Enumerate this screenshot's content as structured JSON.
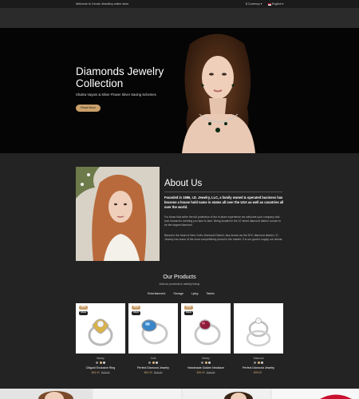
{
  "topbar": {
    "welcome": "Welcome to Cerato Jewellery online store",
    "currency": "$ Currency ▾",
    "language": "English ▾"
  },
  "hero": {
    "title": "Diamonds Jewelry Collection",
    "subtitle": "Shukra Vayam & Silver Flower Silver Saving Schemes",
    "button_label": "Read More"
  },
  "about": {
    "title": "About Us",
    "lead": "Founded in 1986, I.D. Jewelry, LLC, a family owned & operated business has become a house hold name in states all over the USA as well as countries all over the world.",
    "p1": "For those that seller the full protection of the in-store experience we welcome your company and look forward to meeting you face to face. Being located in the 47 street diamond district, known to be the largest diamond.",
    "p2": "Based in the heart of New York's Diamond District, also known as the NYC diamond district, I.D. Jewelry has some of the most competitively priced in the market. It is our goal to supply our clients."
  },
  "products": {
    "title": "Our Products",
    "subtitle": "Add our products to weekly lineup",
    "tabs": [
      "Entertainment",
      "Storage",
      "Lying",
      "Tables"
    ],
    "items": [
      {
        "badge_new": "NEW",
        "badge_sale": "SALE",
        "category": "Money",
        "name": "Citigold Exclusive Ring",
        "price": "$65.00",
        "old_price": "$70.00",
        "dots": [
          "#8a8a8a",
          "#d7b77d",
          "#cfcfcf"
        ]
      },
      {
        "badge_new": "NEW",
        "badge_sale": "SALE",
        "category": "Gold",
        "name": "Perfect Diamond Jewelry",
        "price": "$60.00",
        "old_price": "$70.00",
        "dots": [
          "#8a8a8a",
          "#d7b77d",
          "#cfcfcf"
        ]
      },
      {
        "badge_new": "NEW",
        "badge_sale": "SALE",
        "category": "Money",
        "name": "Handmade Golden Necklace",
        "price": "$35.00",
        "old_price": "$46.00",
        "dots": [
          "#8a8a8a",
          "#d7b77d",
          "#cfcfcf"
        ]
      },
      {
        "badge_new": "",
        "badge_sale": "",
        "category": "Diamond",
        "name": "Perfect Diamond Jewelry",
        "price": "$95.00",
        "old_price": "",
        "dots": [
          "#8a8a8a",
          "#d7b77d",
          "#cfcfcf"
        ]
      }
    ]
  },
  "colors": {
    "accent": "#c9a06a",
    "background": "#232323",
    "hero_bg": "#050505"
  }
}
